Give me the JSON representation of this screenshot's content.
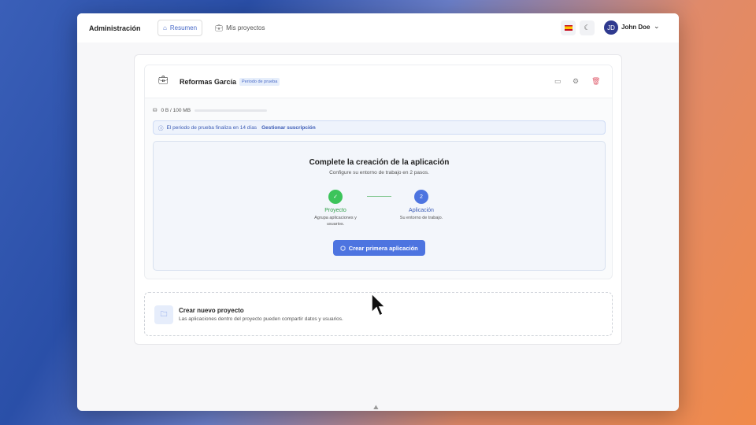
{
  "header": {
    "brand": "Administración",
    "tabs": [
      {
        "label": "Resumen",
        "icon": "home-icon"
      },
      {
        "label": "Mis proyectos",
        "icon": "briefcase-icon"
      }
    ],
    "user": {
      "initials": "JD",
      "name": "John Doe"
    }
  },
  "project": {
    "name": "Reformas García",
    "badge": "Periodo de prueba",
    "storage": "0 B / 100 MB",
    "storage_fraction": 0,
    "trial_notice": "El periodo de prueba finaliza en 14 días",
    "manage_link": "Gestionar suscripción",
    "setup": {
      "title": "Complete la creación de la aplicación",
      "subtitle": "Configure su entorno de trabajo en 2 pasos.",
      "steps": [
        {
          "label": "Proyecto",
          "desc": "Agrupa aplicaciones y usuarios.",
          "marker": "✓"
        },
        {
          "label": "Aplicación",
          "desc": "Su entorno de trabajo.",
          "marker": "2"
        }
      ],
      "button": "Crear primera aplicación"
    }
  },
  "new_project": {
    "title": "Crear nuevo proyecto",
    "desc": "Las aplicaciones dentro del proyecto pueden compartir datos y usuarios."
  },
  "colors": {
    "accent": "#4d74e0",
    "success": "#3cc45a"
  }
}
